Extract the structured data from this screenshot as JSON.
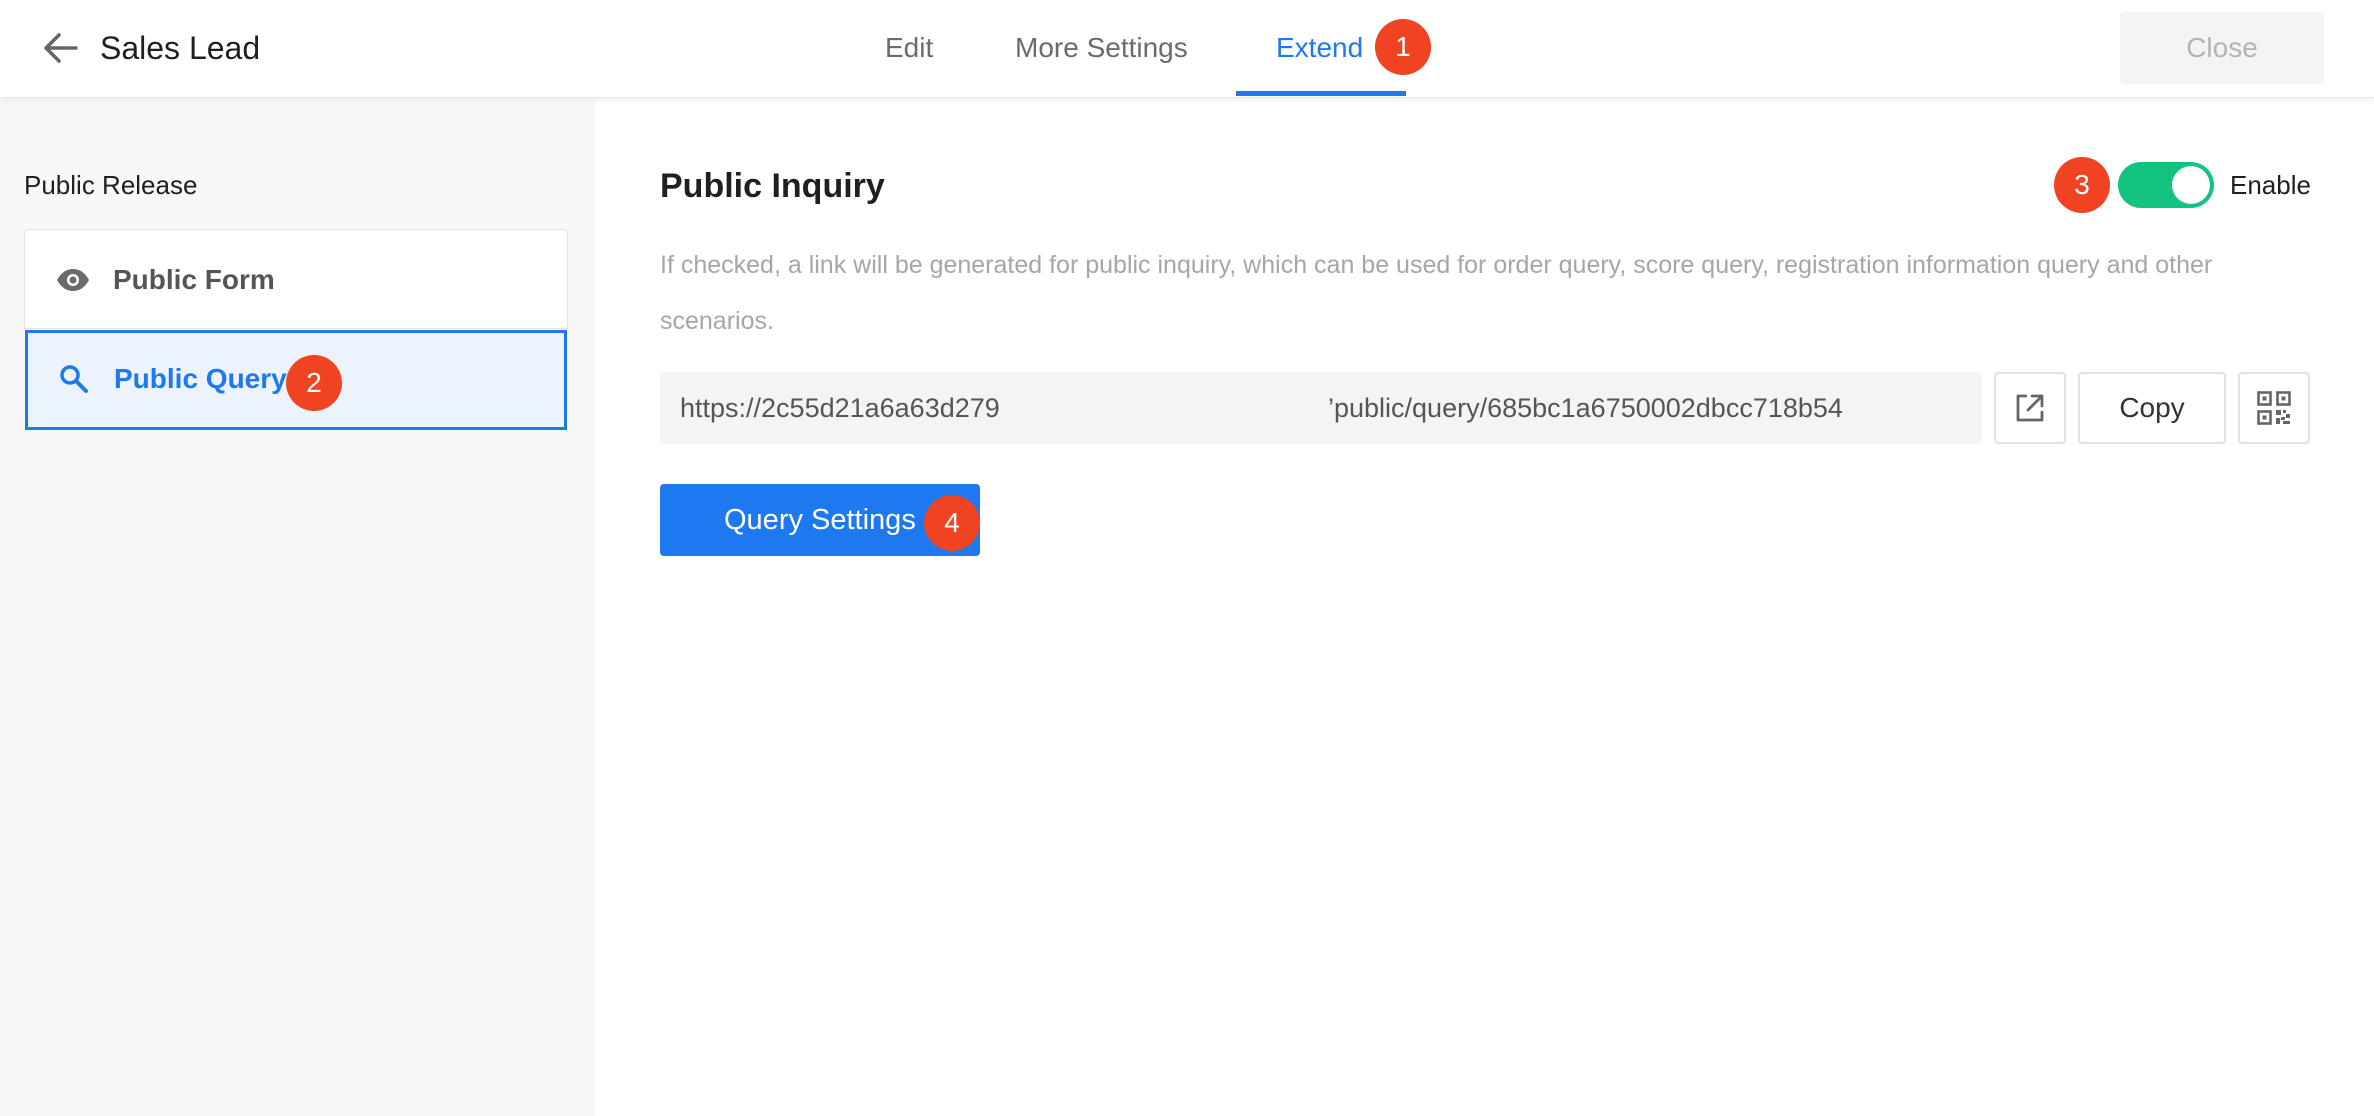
{
  "header": {
    "title": "Sales Lead",
    "back_icon": "arrow-left-icon",
    "tabs": [
      {
        "label": "Edit",
        "active": false
      },
      {
        "label": "More Settings",
        "active": false
      },
      {
        "label": "Extend",
        "active": true
      }
    ],
    "close_label": "Close"
  },
  "sidebar": {
    "section_title": "Public Release",
    "items": [
      {
        "label": "Public Form",
        "icon": "eye-icon",
        "selected": false
      },
      {
        "label": "Public Query",
        "icon": "search-icon",
        "selected": true
      }
    ]
  },
  "main": {
    "title": "Public Inquiry",
    "toggle": {
      "enabled": true,
      "label": "Enable"
    },
    "description": "If checked, a link will be generated for public inquiry, which can be used for order query, score query, registration information query and other scenarios.",
    "url": {
      "part1": "https://2c55d21a6a63d279",
      "part2": "’public/query/685bc1a6750002dbcc718b54"
    },
    "open_icon": "external-link-icon",
    "copy_label": "Copy",
    "qr_icon": "qr-code-icon",
    "query_settings_label": "Query Settings"
  },
  "badges": [
    "1",
    "2",
    "3",
    "4"
  ],
  "colors": {
    "accent": "#1e78f0",
    "toggle_on": "#14c27f",
    "badge": "#ef4322",
    "sidebar_bg": "#f8f8f8"
  }
}
